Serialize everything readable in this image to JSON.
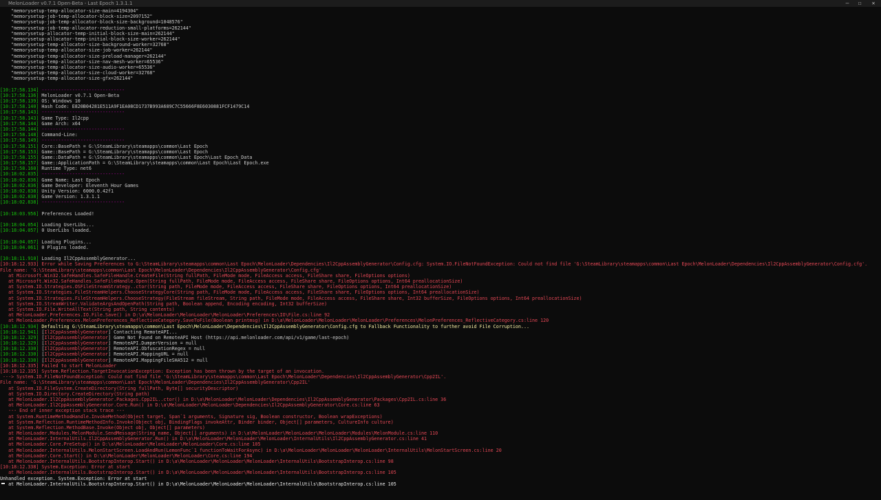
{
  "window": {
    "title": "MelonLoader v0.7.1 Open-Beta - Last Epoch 1.3.1.1",
    "controls": {
      "minimize": "—",
      "maximize": "☐",
      "close": "✕"
    }
  },
  "lines": [
    {
      "parts": [
        {
          "c": "gray",
          "t": "    \"memorysetup-temp-allocator-size-main=4194304\""
        }
      ]
    },
    {
      "parts": [
        {
          "c": "gray",
          "t": "    \"memorysetup-job-temp-allocator-block-size=2097152\""
        }
      ]
    },
    {
      "parts": [
        {
          "c": "gray",
          "t": "    \"memorysetup-job-temp-allocator-block-size-background=1048576\""
        }
      ]
    },
    {
      "parts": [
        {
          "c": "gray",
          "t": "    \"memorysetup-job-temp-allocator-reduction-small-platforms=262144\""
        }
      ]
    },
    {
      "parts": [
        {
          "c": "gray",
          "t": "    \"memorysetup-allocator-temp-initial-block-size-main=262144\""
        }
      ]
    },
    {
      "parts": [
        {
          "c": "gray",
          "t": "    \"memorysetup-allocator-temp-initial-block-size-worker=262144\""
        }
      ]
    },
    {
      "parts": [
        {
          "c": "gray",
          "t": "    \"memorysetup-temp-allocator-size-background-worker=32768\""
        }
      ]
    },
    {
      "parts": [
        {
          "c": "gray",
          "t": "    \"memorysetup-temp-allocator-size-job-worker=262144\""
        }
      ]
    },
    {
      "parts": [
        {
          "c": "gray",
          "t": "    \"memorysetup-temp-allocator-size-preload-manager=262144\""
        }
      ]
    },
    {
      "parts": [
        {
          "c": "gray",
          "t": "    \"memorysetup-temp-allocator-size-nav-mesh-worker=65536\""
        }
      ]
    },
    {
      "parts": [
        {
          "c": "gray",
          "t": "    \"memorysetup-temp-allocator-size-audio-worker=65536\""
        }
      ]
    },
    {
      "parts": [
        {
          "c": "gray",
          "t": "    \"memorysetup-temp-allocator-size-cloud-worker=32768\""
        }
      ]
    },
    {
      "parts": [
        {
          "c": "gray",
          "t": "    \"memorysetup-temp-allocator-size-gfx=262144\""
        }
      ]
    },
    {
      "parts": []
    },
    {
      "parts": [
        {
          "c": "ts",
          "t": "[10:17:58.134]"
        },
        {
          "c": "bar",
          "t": " ------------------------------"
        }
      ]
    },
    {
      "parts": [
        {
          "c": "ts",
          "t": "[10:17:58.136]"
        },
        {
          "c": "gray",
          "t": " MelonLoader v0.7.1 Open-Beta"
        }
      ]
    },
    {
      "parts": [
        {
          "c": "ts",
          "t": "[10:17:58.139]"
        },
        {
          "c": "gray",
          "t": " OS: Windows 10"
        }
      ]
    },
    {
      "parts": [
        {
          "c": "ts",
          "t": "[10:17:58.140]"
        },
        {
          "c": "gray",
          "t": " Hash Code: E820B04281E511A9F1EA08CD1737B993A689C7C55666F8E6030881FCF1479C14"
        }
      ]
    },
    {
      "parts": [
        {
          "c": "ts",
          "t": "[10:17:58.143]"
        },
        {
          "c": "bar",
          "t": " ------------------------------"
        }
      ]
    },
    {
      "parts": [
        {
          "c": "ts",
          "t": "[10:17:58.143]"
        },
        {
          "c": "gray",
          "t": " Game Type: Il2cpp"
        }
      ]
    },
    {
      "parts": [
        {
          "c": "ts",
          "t": "[10:17:58.144]"
        },
        {
          "c": "gray",
          "t": " Game Arch: x64"
        }
      ]
    },
    {
      "parts": [
        {
          "c": "ts",
          "t": "[10:17:58.144]"
        },
        {
          "c": "bar",
          "t": " ------------------------------"
        }
      ]
    },
    {
      "parts": [
        {
          "c": "ts",
          "t": "[10:17:58.148]"
        },
        {
          "c": "gray",
          "t": " Command-Line:"
        }
      ]
    },
    {
      "parts": [
        {
          "c": "ts",
          "t": "[10:17:58.149]"
        },
        {
          "c": "bar",
          "t": " ------------------------------"
        }
      ]
    },
    {
      "parts": [
        {
          "c": "ts",
          "t": "[10:17:58.151]"
        },
        {
          "c": "gray",
          "t": " Core::BasePath = G:\\SteamLibrary\\steamapps\\common\\Last Epoch"
        }
      ]
    },
    {
      "parts": [
        {
          "c": "ts",
          "t": "[10:17:58.153]"
        },
        {
          "c": "gray",
          "t": " Game::BasePath = G:\\SteamLibrary\\steamapps\\common\\Last Epoch"
        }
      ]
    },
    {
      "parts": [
        {
          "c": "ts",
          "t": "[10:17:58.155]"
        },
        {
          "c": "gray",
          "t": " Game::DataPath = G:\\SteamLibrary\\steamapps\\common\\Last Epoch\\Last Epoch_Data"
        }
      ]
    },
    {
      "parts": [
        {
          "c": "ts",
          "t": "[10:17:58.157]"
        },
        {
          "c": "gray",
          "t": " Game::ApplicationPath = G:\\SteamLibrary\\steamapps\\common\\Last Epoch\\Last Epoch.exe"
        }
      ]
    },
    {
      "parts": [
        {
          "c": "ts",
          "t": "[10:17:58.160]"
        },
        {
          "c": "gray",
          "t": " Runtime Type: net6"
        }
      ]
    },
    {
      "parts": [
        {
          "c": "ts",
          "t": "[10:18:02.835]"
        },
        {
          "c": "bar",
          "t": " ------------------------------"
        }
      ]
    },
    {
      "parts": [
        {
          "c": "ts",
          "t": "[10:18:02.836]"
        },
        {
          "c": "gray",
          "t": " Game Name: Last Epoch"
        }
      ]
    },
    {
      "parts": [
        {
          "c": "ts",
          "t": "[10:18:02.836]"
        },
        {
          "c": "gray",
          "t": " Game Developer: Eleventh Hour Games"
        }
      ]
    },
    {
      "parts": [
        {
          "c": "ts",
          "t": "[10:18:02.838]"
        },
        {
          "c": "gray",
          "t": " Unity Version: 6000.0.42f1"
        }
      ]
    },
    {
      "parts": [
        {
          "c": "ts",
          "t": "[10:18:02.838]"
        },
        {
          "c": "gray",
          "t": " Game Version: 1.3.1.1"
        }
      ]
    },
    {
      "parts": [
        {
          "c": "ts",
          "t": "[10:18:02.838]"
        },
        {
          "c": "bar",
          "t": " ------------------------------"
        }
      ]
    },
    {
      "parts": []
    },
    {
      "parts": [
        {
          "c": "ts",
          "t": "[10:18:03.956]"
        },
        {
          "c": "gray",
          "t": " Preferences Loaded!"
        }
      ]
    },
    {
      "parts": []
    },
    {
      "parts": [
        {
          "c": "ts",
          "t": "[10:18:04.054]"
        },
        {
          "c": "gray",
          "t": " Loading UserLibs..."
        }
      ]
    },
    {
      "parts": [
        {
          "c": "ts",
          "t": "[10:18:04.057]"
        },
        {
          "c": "gray",
          "t": " 0 UserLibs loaded."
        }
      ]
    },
    {
      "parts": []
    },
    {
      "parts": [
        {
          "c": "ts",
          "t": "[10:18:04.057]"
        },
        {
          "c": "gray",
          "t": " Loading Plugins..."
        }
      ]
    },
    {
      "parts": [
        {
          "c": "ts",
          "t": "[10:18:04.061]"
        },
        {
          "c": "gray",
          "t": " 0 Plugins loaded."
        }
      ]
    },
    {
      "parts": []
    },
    {
      "parts": [
        {
          "c": "ts",
          "t": "[10:18:11.910]"
        },
        {
          "c": "gray",
          "t": " Loading Il2CppAssemblyGenerator..."
        }
      ]
    },
    {
      "parts": [
        {
          "c": "err",
          "t": "[10:18:12.933] Error while Saving Preferences to G:\\SteamLibrary\\steamapps\\common\\Last Epoch\\MelonLoader\\Dependencies\\Il2CppAssemblyGenerator\\Config.cfg: System.IO.FileNotFoundException: Could not find file 'G:\\SteamLibrary\\steamapps\\common\\Last Epoch\\MelonLoader\\Dependencies\\Il2CppAssemblyGenerator\\Config.cfg'."
        }
      ]
    },
    {
      "parts": [
        {
          "c": "err",
          "t": "File name: 'G:\\SteamLibrary\\steamapps\\common\\Last Epoch\\MelonLoader\\Dependencies\\Il2CppAssemblyGenerator\\Config.cfg'"
        }
      ]
    },
    {
      "parts": [
        {
          "c": "err",
          "t": "   at Microsoft.Win32.SafeHandles.SafeFileHandle.CreateFile(String fullPath, FileMode mode, FileAccess access, FileShare share, FileOptions options)"
        }
      ]
    },
    {
      "parts": [
        {
          "c": "err",
          "t": "   at Microsoft.Win32.SafeHandles.SafeFileHandle.Open(String fullPath, FileMode mode, FileAccess access, FileShare share, FileOptions options, Int64 preallocationSize)"
        }
      ]
    },
    {
      "parts": [
        {
          "c": "err",
          "t": "   at System.IO.Strategies.OSFileStreamStrategy..ctor(String path, FileMode mode, FileAccess access, FileShare share, FileOptions options, Int64 preallocationSize)"
        }
      ]
    },
    {
      "parts": [
        {
          "c": "err",
          "t": "   at System.IO.Strategies.FileStreamHelpers.ChooseStrategyCore(String path, FileMode mode, FileAccess access, FileShare share, FileOptions options, Int64 preallocationSize)"
        }
      ]
    },
    {
      "parts": [
        {
          "c": "err",
          "t": "   at System.IO.Strategies.FileStreamHelpers.ChooseStrategy(FileStream fileStream, String path, FileMode mode, FileAccess access, FileShare share, Int32 bufferSize, FileOptions options, Int64 preallocationSize)"
        }
      ]
    },
    {
      "parts": [
        {
          "c": "err",
          "t": "   at System.IO.StreamWriter.ValidateArgsAndOpenPath(String path, Boolean append, Encoding encoding, Int32 bufferSize)"
        }
      ]
    },
    {
      "parts": [
        {
          "c": "err",
          "t": "   at System.IO.File.WriteAllText(String path, String contents)"
        }
      ]
    },
    {
      "parts": [
        {
          "c": "err",
          "t": "   at MelonLoader.Preferences.IO.File.Save() in D:\\a\\MelonLoader\\MelonLoader\\MelonLoader\\Preferences\\IO\\File.cs:line 92"
        }
      ]
    },
    {
      "parts": [
        {
          "c": "err",
          "t": "   at MelonLoader.Preferences.MelonPreferences_ReflectiveCategory.SaveToFile(Boolean printmsg) in D:\\a\\MelonLoader\\MelonLoader\\MelonLoader\\Preferences\\MelonPreferences_ReflectiveCategory.cs:line 120"
        }
      ]
    },
    {
      "parts": [
        {
          "c": "ts",
          "t": "[10:18:12.934]"
        },
        {
          "c": "warn",
          "t": " Defaulting G:\\SteamLibrary\\steamapps\\common\\Last Epoch\\MelonLoader\\Dependencies\\Il2CppAssemblyGenerator\\Config.cfg to Fallback Functionality to further avoid File Corruption..."
        }
      ]
    },
    {
      "parts": [
        {
          "c": "ts",
          "t": "[10:18:12.941]"
        },
        {
          "c": "gray",
          "t": " ["
        },
        {
          "c": "tag",
          "t": "Il2CppAssemblyGenerator"
        },
        {
          "c": "gray",
          "t": "] Contacting RemoteAPI..."
        }
      ]
    },
    {
      "parts": [
        {
          "c": "ts",
          "t": "[10:18:12.329]"
        },
        {
          "c": "gray",
          "t": " ["
        },
        {
          "c": "tag",
          "t": "Il2CppAssemblyGenerator"
        },
        {
          "c": "gray",
          "t": "] Game Not Found on RemoteAPI Host (https://api.melonloader.com/api/v1/game/last-epoch)"
        }
      ]
    },
    {
      "parts": [
        {
          "c": "ts",
          "t": "[10:18:12.329]"
        },
        {
          "c": "gray",
          "t": " ["
        },
        {
          "c": "tag",
          "t": "Il2CppAssemblyGenerator"
        },
        {
          "c": "gray",
          "t": "] RemoteAPI.DumperVersion = null"
        }
      ]
    },
    {
      "parts": [
        {
          "c": "ts",
          "t": "[10:18:12.330]"
        },
        {
          "c": "gray",
          "t": " ["
        },
        {
          "c": "tag",
          "t": "Il2CppAssemblyGenerator"
        },
        {
          "c": "gray",
          "t": "] RemoteAPI.ObfuscationRegex = null"
        }
      ]
    },
    {
      "parts": [
        {
          "c": "ts",
          "t": "[10:18:12.330]"
        },
        {
          "c": "gray",
          "t": " ["
        },
        {
          "c": "tag",
          "t": "Il2CppAssemblyGenerator"
        },
        {
          "c": "gray",
          "t": "] RemoteAPI.MappingURL = null"
        }
      ]
    },
    {
      "parts": [
        {
          "c": "ts",
          "t": "[10:18:12.330]"
        },
        {
          "c": "gray",
          "t": " ["
        },
        {
          "c": "tag",
          "t": "Il2CppAssemblyGenerator"
        },
        {
          "c": "gray",
          "t": "] RemoteAPI.MappingFileSHA512 = null"
        }
      ]
    },
    {
      "parts": [
        {
          "c": "err",
          "t": "[10:18:12.335] Failed to start MelonLoader"
        }
      ]
    },
    {
      "parts": [
        {
          "c": "err",
          "t": "[10:18:12.335] System.Reflection.TargetInvocationException: Exception has been thrown by the target of an invocation."
        }
      ]
    },
    {
      "parts": [
        {
          "c": "err",
          "t": " ---> System.IO.FileNotFoundException: Could not find file 'G:\\SteamLibrary\\steamapps\\common\\Last Epoch\\MelonLoader\\Dependencies\\Il2CppAssemblyGenerator\\Cpp2IL'."
        }
      ]
    },
    {
      "parts": [
        {
          "c": "err",
          "t": "File name: 'G:\\SteamLibrary\\steamapps\\common\\Last Epoch\\MelonLoader\\Dependencies\\Il2CppAssemblyGenerator\\Cpp2IL'"
        }
      ]
    },
    {
      "parts": [
        {
          "c": "err",
          "t": "   at System.IO.FileSystem.CreateDirectory(String fullPath, Byte[] securityDescriptor)"
        }
      ]
    },
    {
      "parts": [
        {
          "c": "err",
          "t": "   at System.IO.Directory.CreateDirectory(String path)"
        }
      ]
    },
    {
      "parts": [
        {
          "c": "err",
          "t": "   at MelonLoader.Il2CppAssemblyGenerator.Packages.Cpp2IL..ctor() in D:\\a\\MelonLoader\\MelonLoader\\Dependencies\\Il2CppAssemblyGenerator\\Packages\\Cpp2IL.cs:line 36"
        }
      ]
    },
    {
      "parts": [
        {
          "c": "err",
          "t": "   at MelonLoader.Il2CppAssemblyGenerator.Core.Run() in D:\\a\\MelonLoader\\MelonLoader\\Dependencies\\Il2CppAssemblyGenerator\\Core.cs:line 63"
        }
      ]
    },
    {
      "parts": [
        {
          "c": "err",
          "t": "   --- End of inner exception stack trace ---"
        }
      ]
    },
    {
      "parts": [
        {
          "c": "err",
          "t": "   at System.RuntimeMethodHandle.InvokeMethod(Object target, Span`1 arguments, Signature sig, Boolean constructor, Boolean wrapExceptions)"
        }
      ]
    },
    {
      "parts": [
        {
          "c": "err",
          "t": "   at System.Reflection.RuntimeMethodInfo.Invoke(Object obj, BindingFlags invokeAttr, Binder binder, Object[] parameters, CultureInfo culture)"
        }
      ]
    },
    {
      "parts": [
        {
          "c": "err",
          "t": "   at System.Reflection.MethodBase.Invoke(Object obj, Object[] parameters)"
        }
      ]
    },
    {
      "parts": [
        {
          "c": "err",
          "t": "   at MelonLoader.Modules.MelonModule.SendMessage(String name, Object[] arguments) in D:\\a\\MelonLoader\\MelonLoader\\MelonLoader\\Modules\\MelonModule.cs:line 110"
        }
      ]
    },
    {
      "parts": [
        {
          "c": "err",
          "t": "   at MelonLoader.InternalUtils.Il2CppAssemblyGenerator.Run() in D:\\a\\MelonLoader\\MelonLoader\\MelonLoader\\InternalUtils\\Il2CppAssemblyGenerator.cs:line 41"
        }
      ]
    },
    {
      "parts": [
        {
          "c": "err",
          "t": "   at MelonLoader.Core.PreSetup() in D:\\a\\MelonLoader\\MelonLoader\\MelonLoader\\Core.cs:line 105"
        }
      ]
    },
    {
      "parts": [
        {
          "c": "err",
          "t": "   at MelonLoader.InternalUtils.MelonStartScreen.LoadAndRun(LemonFunc`1 functionToWaitForAsync) in D:\\a\\MelonLoader\\MelonLoader\\MelonLoader\\InternalUtils\\MelonStartScreen.cs:line 20"
        }
      ]
    },
    {
      "parts": [
        {
          "c": "err",
          "t": "   at MelonLoader.Core.Start() in D:\\a\\MelonLoader\\MelonLoader\\MelonLoader\\Core.cs:line 194"
        }
      ]
    },
    {
      "parts": [
        {
          "c": "err",
          "t": "   at MelonLoader.InternalUtils.BootstrapInterop.Start() in D:\\a\\MelonLoader\\MelonLoader\\MelonLoader\\InternalUtils\\BootstrapInterop.cs:line 98"
        }
      ]
    },
    {
      "parts": [
        {
          "c": "err",
          "t": "[10:18:12.338] System.Exception: Error at start"
        }
      ]
    },
    {
      "parts": [
        {
          "c": "err",
          "t": "   at MelonLoader.InternalUtils.BootstrapInterop.Start() in D:\\a\\MelonLoader\\MelonLoader\\MelonLoader\\InternalUtils\\BootstrapInterop.cs:line 105"
        }
      ]
    },
    {
      "parts": [
        {
          "c": "white",
          "t": "Unhandled exception. System.Exception: Error at start"
        }
      ]
    },
    {
      "parts": [
        {
          "c": "white",
          "t": "   at MelonLoader.InternalUtils.BootstrapInterop.Start() in D:\\a\\MelonLoader\\MelonLoader\\MelonLoader\\InternalUtils\\BootstrapInterop.cs:line 105"
        }
      ]
    }
  ]
}
